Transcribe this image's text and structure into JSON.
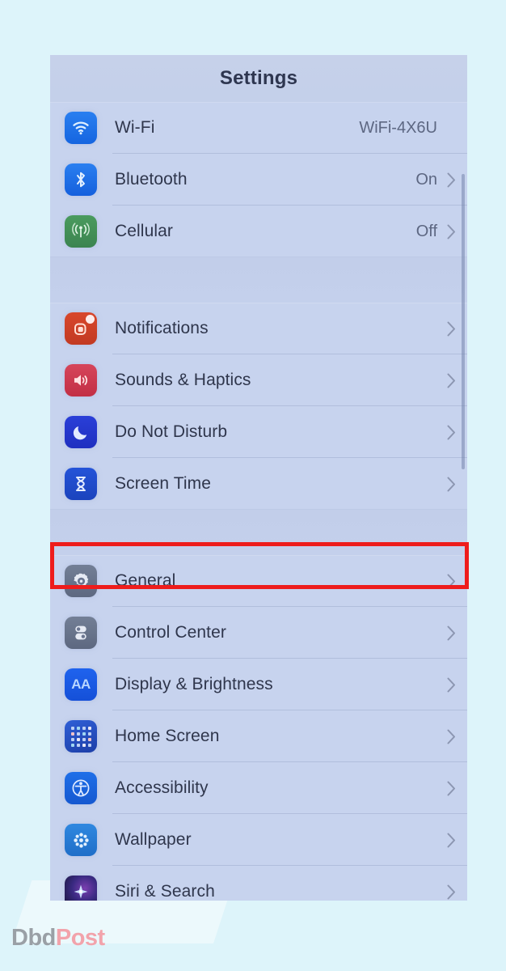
{
  "screen": {
    "nav_title": "Settings"
  },
  "groups": [
    {
      "id": "connectivity",
      "rows": [
        {
          "icon": "wifi-icon",
          "label": "Wi-Fi",
          "value": "WiFi-4X6U"
        },
        {
          "icon": "bluetooth-icon",
          "label": "Bluetooth",
          "value": "On"
        },
        {
          "icon": "cellular-icon",
          "label": "Cellular",
          "value": "Off"
        }
      ]
    },
    {
      "id": "alerts",
      "rows": [
        {
          "icon": "notifications-icon",
          "label": "Notifications",
          "value": ""
        },
        {
          "icon": "sounds-icon",
          "label": "Sounds & Haptics",
          "value": ""
        },
        {
          "icon": "moon-icon",
          "label": "Do Not Disturb",
          "value": ""
        },
        {
          "icon": "hourglass-icon",
          "label": "Screen Time",
          "value": ""
        }
      ]
    },
    {
      "id": "system",
      "rows": [
        {
          "icon": "gear-icon",
          "label": "General",
          "value": ""
        },
        {
          "icon": "control-center-icon",
          "label": "Control Center",
          "value": ""
        },
        {
          "icon": "aa-icon",
          "label": "Display & Brightness",
          "value": ""
        },
        {
          "icon": "home-screen-icon",
          "label": "Home Screen",
          "value": ""
        },
        {
          "icon": "accessibility-icon",
          "label": "Accessibility",
          "value": ""
        },
        {
          "icon": "wallpaper-icon",
          "label": "Wallpaper",
          "value": ""
        },
        {
          "icon": "siri-icon",
          "label": "Siri & Search",
          "value": ""
        }
      ]
    }
  ],
  "annotation": {
    "highlight_target": "General",
    "highlight_color": "#ee1c1c"
  },
  "watermark": {
    "part1": "Dbd",
    "part2": "Post",
    "color1": "#9aa0a6",
    "color2": "#f2a3ab"
  }
}
